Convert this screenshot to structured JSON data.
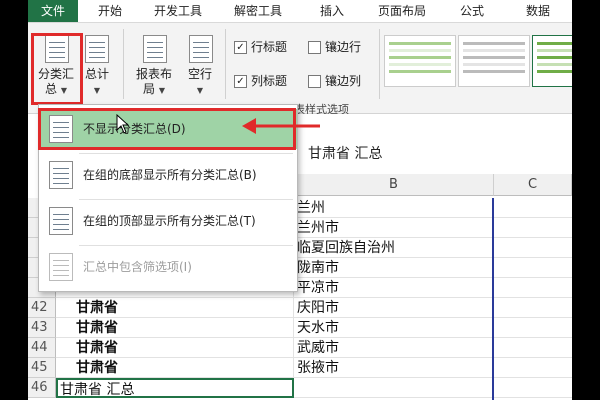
{
  "tabs": [
    "文件",
    "开始",
    "开发工具",
    "解密工具",
    "插入",
    "页面布局",
    "公式",
    "数据"
  ],
  "ribbon": {
    "subtotal_label_1": "分类汇",
    "subtotal_label_2": "总",
    "grandtotal_label": "总计",
    "report_layout_label_1": "报表布",
    "report_layout_label_2": "局",
    "blank_rows_label": "空行",
    "row_headers_label": "行标题",
    "column_headers_label": "列标题",
    "banded_rows_label": "镶边行",
    "banded_columns_label": "镶边列",
    "style_options_group": "表样式选项",
    "row_headers_checked": "✓",
    "column_headers_checked": "✓"
  },
  "colors": {
    "file_tab": "#217346",
    "selected_item": "#9fd3a6",
    "highlight": "#e02a2a"
  },
  "formula_value": "甘肃省 汇总",
  "columns": [
    "B",
    "C"
  ],
  "dropdown": {
    "items": [
      {
        "label": "不显示分类汇总(D)",
        "selected": true
      },
      {
        "label": "在组的底部显示所有分类汇总(B)"
      },
      {
        "label": "在组的顶部显示所有分类汇总(T)"
      },
      {
        "label": "汇总中包含筛选项(I)",
        "disabled": true
      }
    ]
  },
  "rows": [
    {
      "num": "",
      "a": "",
      "b": "兰州"
    },
    {
      "num": "",
      "a": "",
      "b": "兰州市"
    },
    {
      "num": "",
      "a": "",
      "b": "临夏回族自治州"
    },
    {
      "num": "",
      "a": "",
      "b": "陇南市"
    },
    {
      "num": "",
      "a": "",
      "b": "平凉市"
    },
    {
      "num": "42",
      "a": "甘肃省",
      "b": "庆阳市"
    },
    {
      "num": "43",
      "a": "甘肃省",
      "b": "天水市"
    },
    {
      "num": "44",
      "a": "甘肃省",
      "b": "武威市"
    },
    {
      "num": "45",
      "a": "甘肃省",
      "b": "张掖市"
    },
    {
      "num": "46",
      "a": "甘肃省 汇总",
      "b": ""
    }
  ]
}
